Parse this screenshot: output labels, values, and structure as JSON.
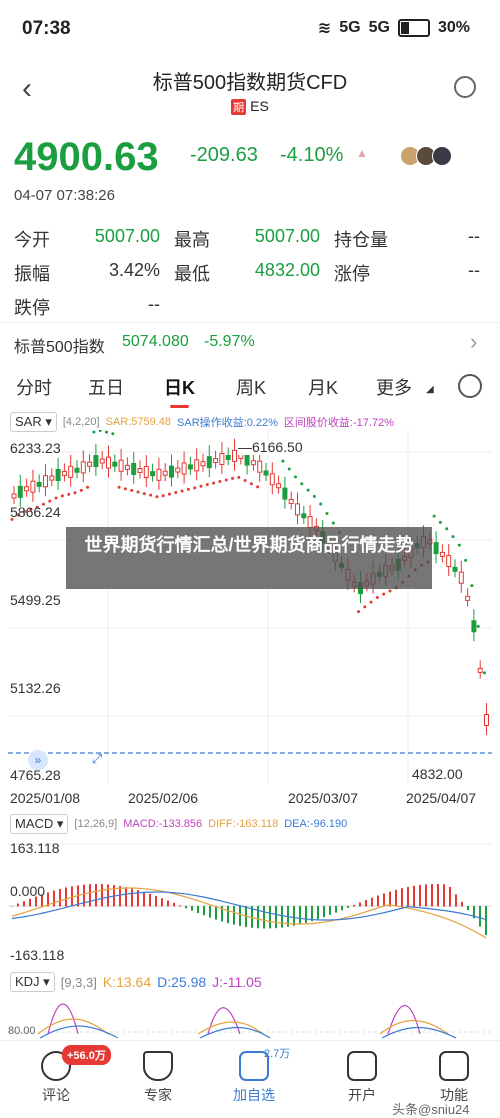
{
  "status": {
    "time": "07:38",
    "net1": "5G",
    "net2": "5G",
    "battery": "30%"
  },
  "header": {
    "title": "标普500指数期货CFD",
    "tag": "期",
    "code": "ES"
  },
  "quote": {
    "price": "4900.63",
    "change": "-209.63",
    "change_pct": "-4.10%",
    "datetime": "04-07 07:38:26"
  },
  "stats": {
    "open_label": "今开",
    "open": "5007.00",
    "high_label": "最高",
    "high": "5007.00",
    "oi_label": "持仓量",
    "oi": "--",
    "amp_label": "振幅",
    "amp": "3.42%",
    "low_label": "最低",
    "low": "4832.00",
    "limit_up_label": "涨停",
    "limit_up": "--",
    "limit_down_label": "跌停",
    "limit_down": "--"
  },
  "index_row": {
    "name": "标普500指数",
    "value": "5074.080",
    "pct": "-5.97%"
  },
  "tabs": [
    "分时",
    "五日",
    "日K",
    "周K",
    "月K",
    "更多"
  ],
  "active_tab": 2,
  "sar": {
    "name": "SAR",
    "params": "[4,2,20]",
    "v1": "SAR:5759.48",
    "v2": "SAR操作收益:0.22%",
    "v3": "区间股价收益:-17.72%"
  },
  "price_axis": {
    "top": "6233.23",
    "l2": "5866.24",
    "l3": "5499.25",
    "l4": "5132.26",
    "bottom": "4765.28",
    "high_mark": "6166.50",
    "last_mark": "4832.00"
  },
  "dates": [
    "2025/01/08",
    "2025/02/06",
    "2025/03/07",
    "2025/04/07"
  ],
  "macd": {
    "name": "MACD",
    "params": "[12,26,9]",
    "v1": "MACD:-133.856",
    "v2": "DIFF:-163.118",
    "v3": "DEA:-96.190",
    "axis_top": "163.118",
    "axis_mid": "0.000",
    "axis_bot": "-163.118"
  },
  "kdj": {
    "name": "KDJ",
    "params": "[9,3,3]",
    "k": "K:13.64",
    "d": "D:25.98",
    "j": "J:-11.05",
    "axis": "80.00"
  },
  "overlay": "世界期货行情汇总/世界期货商品行情走势",
  "bottom": {
    "items": [
      {
        "label": "评论",
        "badge": "+56.0万"
      },
      {
        "label": "专家"
      },
      {
        "label": "加自选",
        "badge": "2.7万"
      },
      {
        "label": "开户"
      },
      {
        "label": "功能"
      }
    ],
    "watermark": "头条@sniu24"
  },
  "colors": {
    "up": "#e53935",
    "down": "#1a9e3f"
  }
}
